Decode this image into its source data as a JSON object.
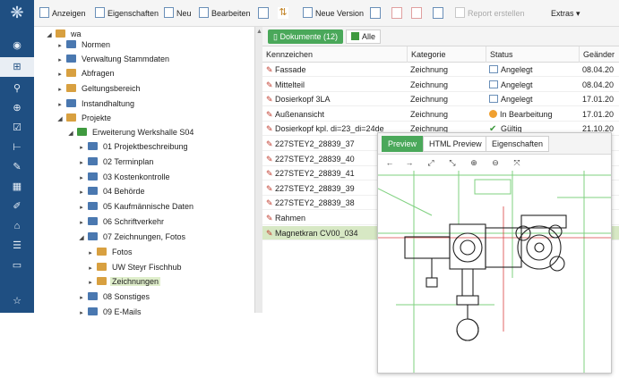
{
  "toolbar": {
    "anzeigen": "Anzeigen",
    "eigenschaften": "Eigenschaften",
    "neu": "Neu",
    "bearbeiten": "Bearbeiten",
    "neue_version": "Neue Version",
    "report_erstellen": "Report erstellen",
    "extras": "Extras"
  },
  "tree": {
    "items": [
      {
        "label": "wa"
      },
      {
        "label": "Normen"
      },
      {
        "label": "Verwaltung Stammdaten"
      },
      {
        "label": "Abfragen"
      },
      {
        "label": "Geltungsbereich"
      },
      {
        "label": "Instandhaltung"
      },
      {
        "label": "Projekte"
      },
      {
        "label": "Erweiterung Werkshalle S04"
      },
      {
        "label": "01 Projektbeschreibung"
      },
      {
        "label": "02 Terminplan"
      },
      {
        "label": "03 Kostenkontrolle"
      },
      {
        "label": "04 Behörde"
      },
      {
        "label": "05 Kaufmännische Daten"
      },
      {
        "label": "06 Schriftverkehr"
      },
      {
        "label": "07 Zeichnungen, Fotos"
      },
      {
        "label": "Fotos"
      },
      {
        "label": "UW Steyr Fischhub"
      },
      {
        "label": "Zeichnungen"
      },
      {
        "label": "08 Sonstiges"
      },
      {
        "label": "09 E-Mails"
      }
    ]
  },
  "docs": {
    "tab_documents": "Dokumente (12)",
    "tab_all": "Alle",
    "columns": [
      "Kennzeichen",
      "Kategorie",
      "Status",
      "Geänder"
    ],
    "rows": [
      {
        "name": "Fassade",
        "category": "Zeichnung",
        "status": "Angelegt",
        "date": "08.04.20"
      },
      {
        "name": "Mittelteil",
        "category": "Zeichnung",
        "status": "Angelegt",
        "date": "08.04.20"
      },
      {
        "name": "Dosierkopf 3LA",
        "category": "Zeichnung",
        "status": "Angelegt",
        "date": "17.01.20"
      },
      {
        "name": "Außenansicht",
        "category": "Zeichnung",
        "status": "In Bearbeitung",
        "date": "17.01.20"
      },
      {
        "name": "Dosierkopf kpl. di=23_di=24de",
        "category": "Zeichnung",
        "status": "Gültig",
        "date": "21.10.20"
      },
      {
        "name": "227STEY2_28839_37",
        "category": "",
        "status": "",
        "date": ""
      },
      {
        "name": "227STEY2_28839_40",
        "category": "",
        "status": "",
        "date": ""
      },
      {
        "name": "227STEY2_28839_41",
        "category": "",
        "status": "",
        "date": ""
      },
      {
        "name": "227STEY2_28839_39",
        "category": "",
        "status": "",
        "date": ""
      },
      {
        "name": "227STEY2_28839_38",
        "category": "",
        "status": "",
        "date": ""
      },
      {
        "name": "Rahmen",
        "category": "",
        "status": "",
        "date": ""
      },
      {
        "name": "Magnetkran CV00_034",
        "category": "",
        "status": "",
        "date": ""
      }
    ]
  },
  "preview": {
    "tab_preview": "Preview",
    "tab_html": "HTML Preview",
    "tab_props": "Eigenschaften"
  }
}
